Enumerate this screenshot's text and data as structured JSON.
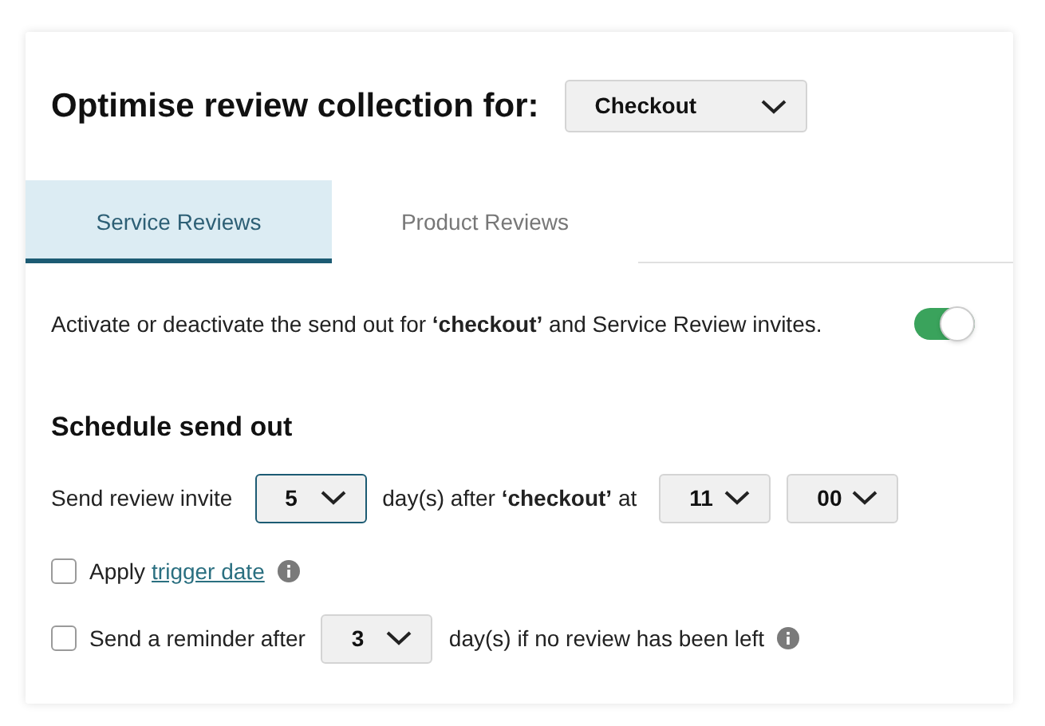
{
  "header": {
    "title": "Optimise review collection for:",
    "dropdown": {
      "value": "Checkout",
      "focused": false
    }
  },
  "tabs": [
    {
      "label": "Service Reviews",
      "selected": true
    },
    {
      "label": "Product Reviews",
      "selected": false
    }
  ],
  "activation": {
    "text": "Activate or deactivate the send out for **‘checkout’** and Service Review invites.",
    "on": true
  },
  "schedule": {
    "title": "Schedule send out",
    "invite": {
      "label": "Send review invite",
      "days": {
        "value": "5",
        "focused": true
      },
      "after_text": "day(s) after **‘checkout’** at",
      "hour": {
        "value": "11",
        "focused": false
      },
      "minute": {
        "value": "00",
        "focused": false
      }
    },
    "trigger": {
      "checked": false,
      "prefix": "Apply",
      "link": "trigger date"
    },
    "reminder": {
      "checked": false,
      "label": "Send a reminder after",
      "days": {
        "value": "3",
        "focused": false
      },
      "suffix": "day(s) if no review has been left"
    }
  }
}
